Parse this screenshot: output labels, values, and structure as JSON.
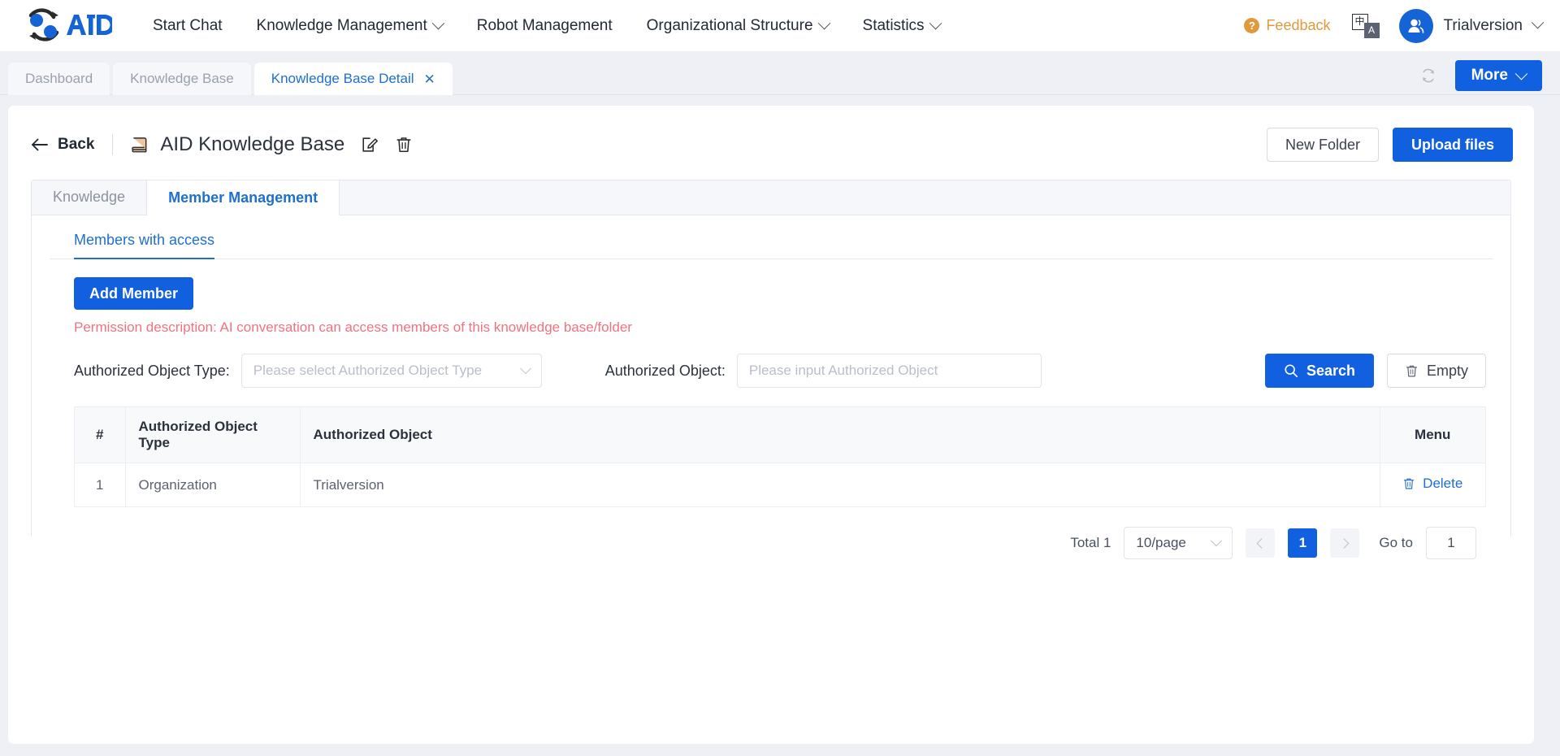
{
  "header": {
    "logo_text": "AID",
    "nav": [
      {
        "label": "Start Chat",
        "has_dropdown": false
      },
      {
        "label": "Knowledge Management",
        "has_dropdown": true
      },
      {
        "label": "Robot Management",
        "has_dropdown": false
      },
      {
        "label": "Organizational Structure",
        "has_dropdown": true
      },
      {
        "label": "Statistics",
        "has_dropdown": true
      }
    ],
    "feedback_label": "Feedback",
    "lang_cn": "中",
    "lang_en": "A",
    "username": "Trialversion"
  },
  "browser_tabs": {
    "items": [
      {
        "label": "Dashboard",
        "active": false,
        "closable": false
      },
      {
        "label": "Knowledge Base",
        "active": false,
        "closable": false
      },
      {
        "label": "Knowledge Base Detail",
        "active": true,
        "closable": true
      }
    ],
    "close_glyph": "✕",
    "more_label": "More"
  },
  "page": {
    "back_label": "Back",
    "title": "AID Knowledge Base",
    "new_folder_label": "New Folder",
    "upload_label": "Upload files"
  },
  "panel": {
    "tabs": [
      {
        "label": "Knowledge",
        "active": false
      },
      {
        "label": "Member Management",
        "active": true
      }
    ],
    "subtab_label": "Members with access",
    "add_member_label": "Add Member",
    "permission_note": "Permission description: AI conversation can access members of this knowledge base/folder"
  },
  "filters": {
    "type_label": "Authorized Object Type:",
    "type_placeholder": "Please select Authorized Object Type",
    "type_value": "",
    "object_label": "Authorized Object:",
    "object_placeholder": "Please input Authorized Object",
    "object_value": "",
    "search_label": "Search",
    "empty_label": "Empty"
  },
  "table": {
    "columns": [
      "#",
      "Authorized Object Type",
      "Authorized Object",
      "Menu"
    ],
    "rows": [
      {
        "index": "1",
        "type": "Organization",
        "object": "Trialversion",
        "action": "Delete"
      }
    ]
  },
  "pagination": {
    "total_label": "Total 1",
    "page_size": "10/page",
    "current_page": "1",
    "goto_label": "Go to",
    "goto_value": "1"
  },
  "colors": {
    "primary": "#1060e0",
    "link": "#1f6fd0",
    "warning": "#e09a3e",
    "danger": "#f0737f",
    "page_bg": "#eef0f5"
  }
}
